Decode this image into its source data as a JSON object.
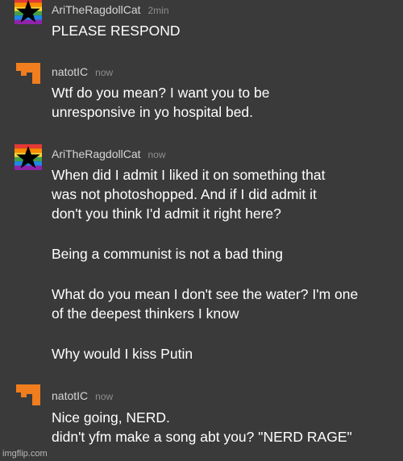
{
  "messages": [
    {
      "author": "AriTheRagdollCat",
      "time": "2min",
      "avatar": "rainbow-star-avatar",
      "paragraphs": [
        [
          "PLEASE RESPOND"
        ]
      ]
    },
    {
      "author": "natotIC",
      "time": "now",
      "avatar": "orange-blocky-avatar",
      "paragraphs": [
        [
          "Wtf do you mean? I want you to be",
          "unresponsive in yo hospital bed."
        ]
      ]
    },
    {
      "author": "AriTheRagdollCat",
      "time": "now",
      "avatar": "rainbow-star-avatar",
      "paragraphs": [
        [
          "When did I admit I liked it on something that",
          "was not photoshopped. And if I did admit it",
          "don't you think I'd admit it right here?"
        ],
        [
          "Being a communist is not a bad thing"
        ],
        [
          "What do you mean I don't see the water? I'm one",
          "of the deepest thinkers I know"
        ],
        [
          "Why would I kiss Putin"
        ]
      ]
    },
    {
      "author": "natotIC",
      "time": "now",
      "avatar": "orange-blocky-avatar",
      "paragraphs": [
        [
          "Nice going, NERD.",
          "didn't yfm make a song abt you? \"NERD RAGE\""
        ]
      ]
    }
  ],
  "watermark": "imgflip.com",
  "colors": {
    "background": "#3a3a3a",
    "text": "#ffffff",
    "author": "#d6d6d6",
    "time": "#8e8e8e",
    "orange": "#f07d1e"
  }
}
